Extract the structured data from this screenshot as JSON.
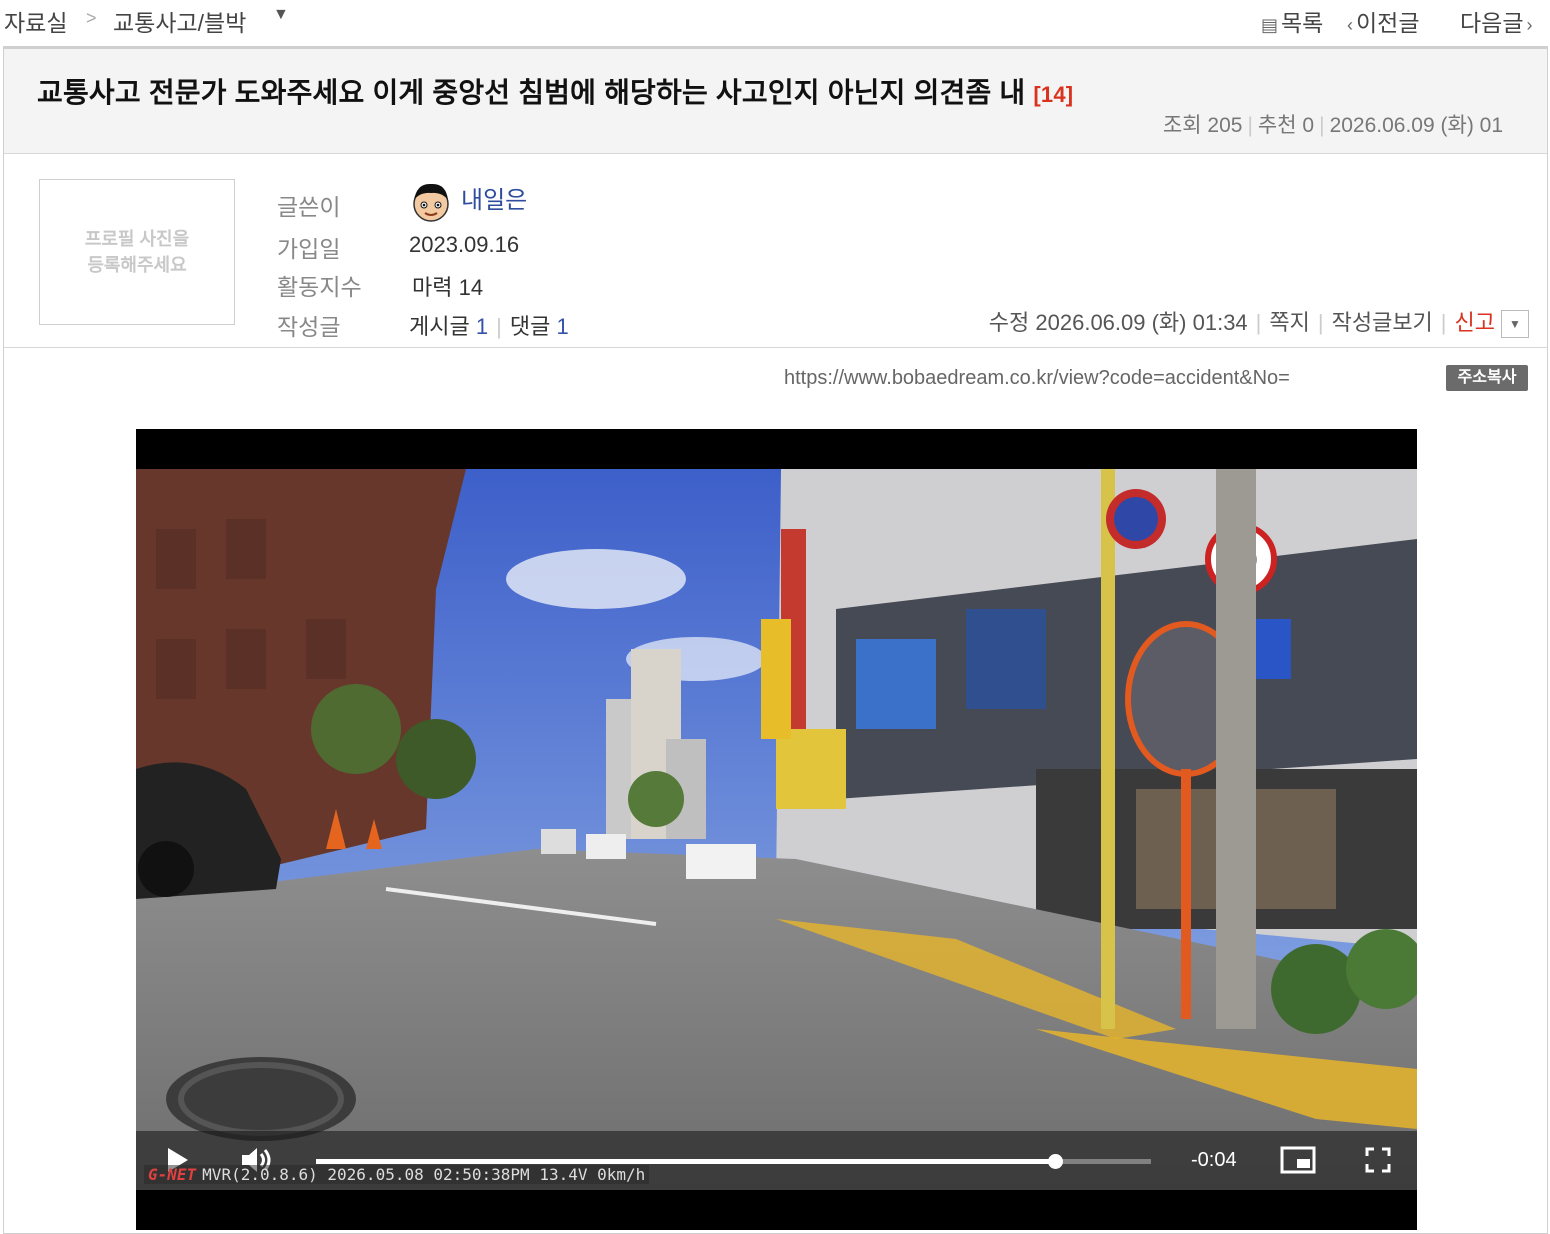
{
  "breadcrumb": {
    "root": "자료실",
    "separator": ">",
    "current": "교통사고/블박",
    "dropdown_icon": "caret-down-icon"
  },
  "nav": {
    "list_label": "목록",
    "prev_label": "이전글",
    "next_label": "다음글"
  },
  "post": {
    "title": "교통사고 전문가 도와주세요 이게 중앙선 침범에 해당하는 사고인지 아닌지 의견좀 내",
    "comment_count": "[14]",
    "views_label": "조회",
    "views": "205",
    "recommend_label": "추천",
    "recommend": "0",
    "date": "2026.06.09 (화) 01"
  },
  "author": {
    "avatar_placeholder_line1": "프로필 사진을",
    "avatar_placeholder_line2": "등록해주세요",
    "writer_label": "글쓴이",
    "nickname": "내일은",
    "join_label": "가입일",
    "join_date": "2023.09.16",
    "activity_label": "활동지수",
    "activity_value": "마력 14",
    "posts_label": "작성글",
    "posts_text": "게시글",
    "posts_count": "1",
    "comments_text": "댓글",
    "comments_count": "1",
    "modified": "수정 2026.06.09 (화) 01:34",
    "message_label": "쪽지",
    "view_posts_label": "작성글보기",
    "report_label": "신고"
  },
  "url_row": {
    "url": "https://www.bobaedream.co.kr/view?code=accident&No=",
    "copy_label": "주소복사"
  },
  "video": {
    "time_remaining": "-0:04",
    "progress_fraction": 0.885,
    "osd_brand": "G-NET",
    "osd_text": "MVR(2.0.8.6) 2026.05.08 02:50:38PM 13.4V   0km/h"
  },
  "colors": {
    "accent_red": "#d9331f",
    "link_blue": "#2d4d9c"
  }
}
